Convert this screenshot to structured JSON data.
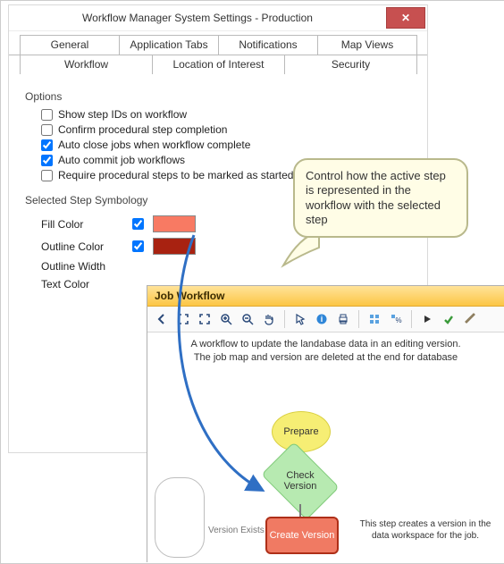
{
  "dialog": {
    "title": "Workflow Manager System Settings - Production",
    "close": "✕",
    "tabs_row1": [
      "General",
      "Application Tabs",
      "Notifications",
      "Map Views"
    ],
    "tabs_row2": [
      "Workflow",
      "Location of Interest",
      "Security"
    ],
    "active_tab": "Workflow",
    "options": {
      "group": "Options",
      "items": [
        {
          "label": "Show step IDs on workflow",
          "checked": false
        },
        {
          "label": "Confirm procedural step completion",
          "checked": false
        },
        {
          "label": "Auto close jobs when workflow complete",
          "checked": true
        },
        {
          "label": "Auto commit job workflows",
          "checked": true
        },
        {
          "label": "Require procedural steps to be marked as started",
          "checked": false
        }
      ]
    },
    "symbology": {
      "group": "Selected Step Symbology",
      "rows": [
        {
          "label": "Fill Color",
          "checked": true,
          "color": "#f87a63"
        },
        {
          "label": "Outline Color",
          "checked": true,
          "color": "#a82211"
        },
        {
          "label": "Outline Width"
        },
        {
          "label": "Text Color"
        }
      ]
    }
  },
  "callout": "Control how the active step is represented in the workflow with the selected step",
  "workflow": {
    "title": "Job Workflow",
    "toolbar_icons": [
      "back-icon",
      "fit-icon",
      "expand-icon",
      "zoom-in-icon",
      "zoom-out-icon",
      "pan-icon",
      "pointer-icon",
      "info-icon",
      "print-icon",
      "select-all-icon",
      "percent-icon",
      "play-icon",
      "check-icon",
      "brush-icon"
    ],
    "description_l1": "A workflow to update the landabase data in an editing version.",
    "description_l2": "The job map and version are deleted at the end for database",
    "nodes": {
      "prepare": "Prepare",
      "check": "Check\nVersion",
      "create": "Create Version"
    },
    "edge_label": "Version Exists",
    "note": "This step creates a version in the data workspace for the job."
  }
}
